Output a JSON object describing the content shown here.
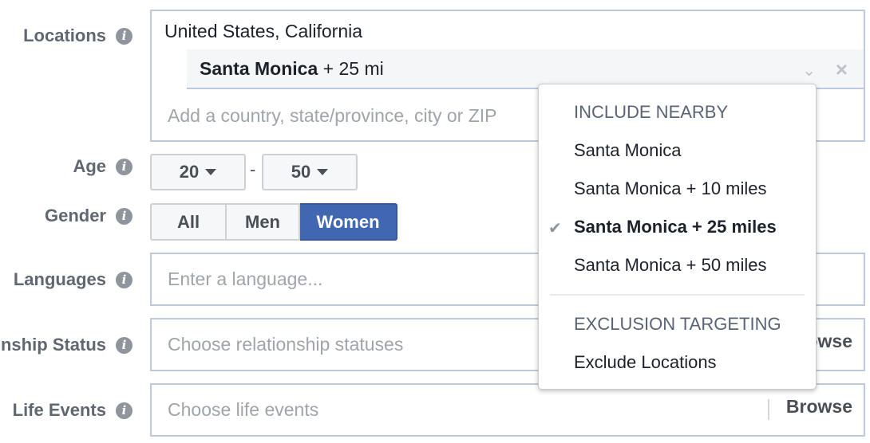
{
  "fields": {
    "locations": {
      "label": "Locations",
      "selected_country": "United States, California",
      "chip": {
        "name": "Santa Monica",
        "radius": "+ 25 mi"
      },
      "input_placeholder": "Add a country, state/province, city or ZIP"
    },
    "age": {
      "label": "Age",
      "min": "20",
      "max": "50",
      "separator": "-"
    },
    "gender": {
      "label": "Gender",
      "options": [
        "All",
        "Men",
        "Women"
      ],
      "selected": "Women"
    },
    "languages": {
      "label": "Languages",
      "placeholder": "Enter a language..."
    },
    "relationship_status": {
      "label": "Relationship Status",
      "placeholder": "Choose relationship statuses",
      "browse_label": "Browse"
    },
    "life_events": {
      "label": "Life Events",
      "placeholder": "Choose life events",
      "browse_label": "Browse"
    }
  },
  "dropdown": {
    "include_header": "INCLUDE NEARBY",
    "include_items": [
      {
        "label": "Santa Monica",
        "selected": false
      },
      {
        "label": "Santa Monica + 10 miles",
        "selected": false
      },
      {
        "label": "Santa Monica + 25 miles",
        "selected": true
      },
      {
        "label": "Santa Monica + 50 miles",
        "selected": false
      }
    ],
    "exclusion_header": "EXCLUSION TARGETING",
    "exclusion_items": [
      {
        "label": "Exclude Locations"
      }
    ]
  },
  "icons": {
    "info": "i",
    "chevron": "⌄",
    "close": "×",
    "check": "✔"
  },
  "colors": {
    "accent": "#4267b2",
    "border": "#bec9db",
    "label": "#606770"
  }
}
